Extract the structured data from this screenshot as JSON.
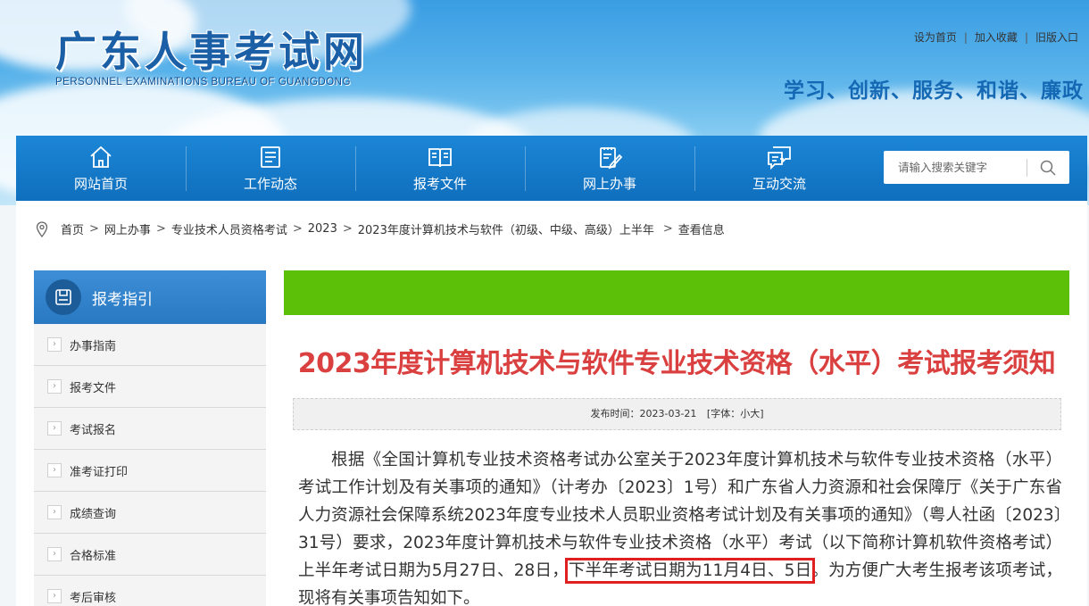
{
  "header": {
    "site_title": "广东人事考试网",
    "site_subtitle": "PERSONNEL EXAMINATIONS BUREAU OF GUANGDONG",
    "slogan": "学习、创新、服务、和谐、廉政",
    "toplinks": [
      {
        "label": "设为首页"
      },
      {
        "label": "加入收藏"
      },
      {
        "label": "旧版入口"
      }
    ]
  },
  "nav": {
    "items": [
      {
        "label": "网站首页",
        "icon": "home-icon"
      },
      {
        "label": "工作动态",
        "icon": "news-icon"
      },
      {
        "label": "报考文件",
        "icon": "book-icon"
      },
      {
        "label": "网上办事",
        "icon": "edit-icon"
      },
      {
        "label": "互动交流",
        "icon": "chat-icon"
      }
    ],
    "search_placeholder": "请输入搜索关键字"
  },
  "breadcrumb": {
    "items": [
      "首页",
      "网上办事",
      "专业技术人员资格考试",
      "2023",
      "2023年度计算机技术与软件（初级、中级、高级）上半年",
      "查看信息"
    ]
  },
  "sidebar": {
    "title": "报考指引",
    "items": [
      {
        "label": "办事指南"
      },
      {
        "label": "报考文件"
      },
      {
        "label": "考试报名"
      },
      {
        "label": "准考证打印"
      },
      {
        "label": "成绩查询"
      },
      {
        "label": "合格标准"
      },
      {
        "label": "考后审核"
      }
    ]
  },
  "article": {
    "title": "2023年度计算机技术与软件专业技术资格（水平）考试报考须知",
    "publish_time": "发布时间：2023-03-21",
    "font_size": "[字体：小大]",
    "paragraph_part1": "根据《全国计算机专业技术资格考试办公室关于2023年度计算机技术与软件专业技术资格（水平）考试工作计划及有关事项的通知》（计考办〔2023〕1号）和广东省人力资源和社会保障厅《关于广东省人力资源社会保障系统2023年度专业技术人员职业资格考试计划及有关事项的通知》（粤人社函〔2023〕31号）要求，2023年度计算机技术与软件专业技术资格（水平）考试（以下简称计算机软件资格考试）上半年考试日期为5月27日、28日，",
    "paragraph_highlight": "下半年考试日期为11月4日、5日",
    "paragraph_part2": "。为方便广大考生报考该项考试，现将有关事项告知如下。"
  },
  "colors": {
    "nav_blue": "#1277c6",
    "title_red": "#d9403f",
    "green_bar": "#5cbf08",
    "highlight_box": "#e02020"
  }
}
